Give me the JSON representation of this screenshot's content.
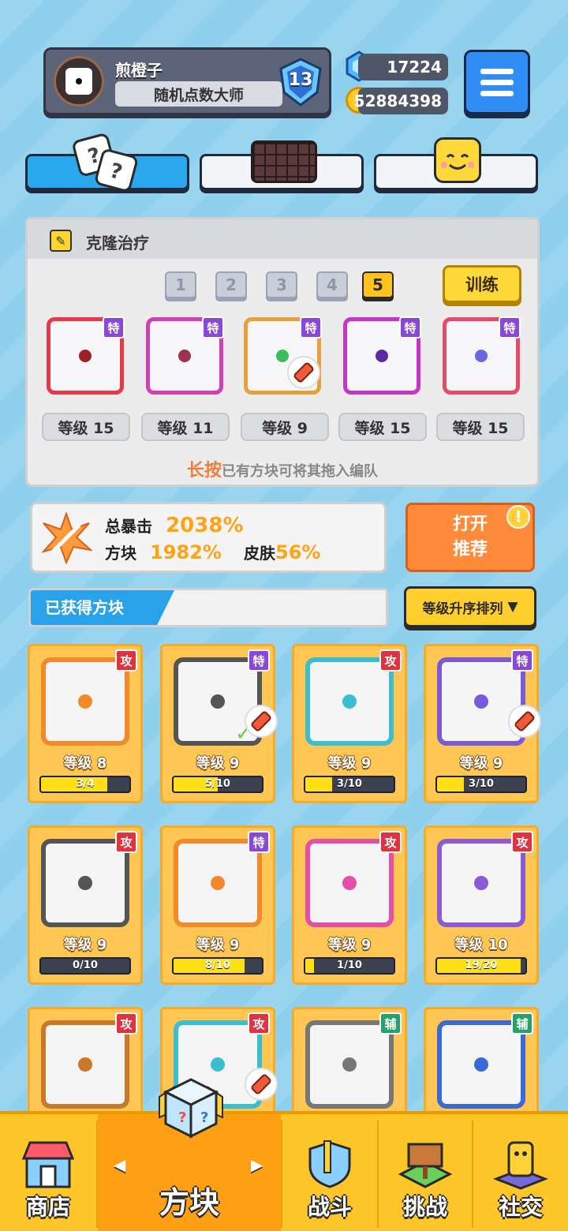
{
  "profile": {
    "name": "煎橙子",
    "title": "随机点数大师",
    "rank": "13"
  },
  "currency": {
    "gems": "17224",
    "coins": "52884398"
  },
  "deck": {
    "name": "克隆治疗",
    "slots": [
      "1",
      "2",
      "3",
      "4",
      "5"
    ],
    "active_slot": "5",
    "train_label": "训练",
    "cards": [
      {
        "badge": "特",
        "level": "等级 15",
        "border": "#e8394a"
      },
      {
        "badge": "特",
        "level": "等级 11",
        "border": "#d43fb0"
      },
      {
        "badge": "特",
        "level": "等级 9",
        "border": "#e7a13a"
      },
      {
        "badge": "特",
        "level": "等级 15",
        "border": "#c436c9"
      },
      {
        "badge": "特",
        "level": "等级 15",
        "border": "#e64a6a"
      }
    ],
    "hint_highlight": "长按",
    "hint_text": "已有方块可将其拖入编队"
  },
  "crit": {
    "total_label": "总暴击",
    "total_value": "2038%",
    "block_label": "方块",
    "block_value": "1982%",
    "skin_label": "皮肤",
    "skin_value": "56%"
  },
  "recommend": {
    "line1": "打开",
    "line2": "推荐",
    "alert": "!"
  },
  "owned": {
    "label": "已获得方块",
    "sort_label": "等级升序排列",
    "sort_arrow": "▼"
  },
  "blocks": [
    {
      "badge": "攻",
      "level": "等级 8",
      "progress": "3/4",
      "fill": 0.75,
      "color": "#f08a2a"
    },
    {
      "badge": "特",
      "level": "等级 9",
      "progress": "5/10",
      "fill": 0.5,
      "color": "#555555"
    },
    {
      "badge": "攻",
      "level": "等级 9",
      "progress": "3/10",
      "fill": 0.3,
      "color": "#3bbfd0"
    },
    {
      "badge": "特",
      "level": "等级 9",
      "progress": "3/10",
      "fill": 0.3,
      "color": "#7a5ad8"
    },
    {
      "badge": "攻",
      "level": "等级 9",
      "progress": "0/10",
      "fill": 0.0,
      "color": "#555555"
    },
    {
      "badge": "特",
      "level": "等级 9",
      "progress": "8/10",
      "fill": 0.8,
      "color": "#f08a2a"
    },
    {
      "badge": "攻",
      "level": "等级 9",
      "progress": "1/10",
      "fill": 0.1,
      "color": "#e54fa8"
    },
    {
      "badge": "攻",
      "level": "等级 10",
      "progress": "19/20",
      "fill": 0.95,
      "color": "#8a5ad8"
    },
    {
      "badge": "攻",
      "level": "",
      "progress": "",
      "fill": 0.0,
      "color": "#c8782a"
    },
    {
      "badge": "攻",
      "level": "",
      "progress": "",
      "fill": 0.0,
      "color": "#3bbfd0"
    },
    {
      "badge": "辅",
      "level": "",
      "progress": "",
      "fill": 0.0,
      "color": "#777777"
    },
    {
      "badge": "辅",
      "level": "",
      "progress": "",
      "fill": 0.0,
      "color": "#3b6ad8"
    }
  ],
  "nav": {
    "shop": "商店",
    "blocks": "方块",
    "battle": "战斗",
    "challenge": "挑战",
    "social": "社交",
    "left_arrow": "◀",
    "right_arrow": "▶"
  },
  "colors": {
    "accent_blue": "#2aa8ee",
    "accent_yellow": "#ffc629",
    "crit_orange": "#ffa316",
    "attack_red": "#e0333f",
    "special_purple": "#8a48d8",
    "support_green": "#27a16b"
  },
  "icons": {
    "avatar": "dice-avatar-icon",
    "rank": "rank-shield-icon",
    "gem": "gem-icon",
    "coin": "coin-icon",
    "menu": "hamburger-menu-icon",
    "pencil": "pencil-icon",
    "eraser": "eraser-icon",
    "crit": "crit-sword-icon"
  }
}
